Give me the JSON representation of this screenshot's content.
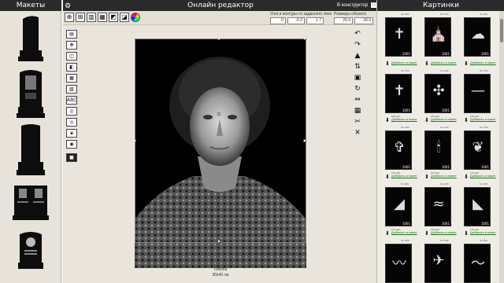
{
  "left_panel": {
    "title": "Макеты"
  },
  "center_panel": {
    "title": "Онлайн редактор",
    "constructor_label": "В конструктор",
    "toolbar": {
      "color_icon": "color-wheel-icon"
    },
    "options": {
      "angle_label": "Угол и контуры от заданного левого угла",
      "angle_value": "0",
      "x_value": "-0.2",
      "y_value": "1.7",
      "size_label": "Размеры объекта",
      "w_value": "29.9",
      "h_value": "39.9"
    },
    "left_tools": [
      {
        "label": "▤"
      },
      {
        "label": "✥"
      },
      {
        "label": "◫"
      },
      {
        "label": "◧"
      },
      {
        "label": "▦"
      },
      {
        "label": "▧"
      },
      {
        "label": "ABC"
      },
      {
        "label": "◎"
      },
      {
        "label": "⌂"
      },
      {
        "label": "◈"
      },
      {
        "label": "◉"
      },
      {
        "label": "■"
      }
    ],
    "right_tools": [
      {
        "label": "↶"
      },
      {
        "label": "↷"
      },
      {
        "label": "▲"
      },
      {
        "label": "⇅"
      },
      {
        "label": "▣"
      },
      {
        "label": "↻"
      },
      {
        "label": "⇔"
      },
      {
        "label": "▦"
      },
      {
        "label": "✂"
      },
      {
        "label": "✕"
      }
    ],
    "canvas_caption_1": "Плитка",
    "canvas_caption_2": "30x40 см"
  },
  "right_panel": {
    "title": "Картинки",
    "add_label": "Добавить в макет",
    "items": [
      {
        "id": "№ 1869",
        "num": "1001",
        "price": ""
      },
      {
        "id": "№ 1875",
        "num": "1001",
        "price": ""
      },
      {
        "id": "№ 2001",
        "num": "1001",
        "price": ""
      },
      {
        "id": "№ 1796",
        "num": "1001",
        "price": "130 руб."
      },
      {
        "id": "№ 1842",
        "num": "1001",
        "price": "170 руб."
      },
      {
        "id": "№ 1794",
        "num": "",
        "price": "170 руб."
      },
      {
        "id": "№ 1905",
        "num": "1001",
        "price": "170 руб."
      },
      {
        "id": "№ 1706",
        "num": "1001",
        "price": "170 руб."
      },
      {
        "id": "№ 1798",
        "num": "1001",
        "price": "170 руб."
      },
      {
        "id": "№ 0002",
        "num": "1001",
        "price": "170 руб."
      },
      {
        "id": "№ 1629",
        "num": "1001",
        "price": "170 руб."
      },
      {
        "id": "№ 1626",
        "num": "1001",
        "price": "170 руб."
      },
      {
        "id": "№ 1809",
        "num": "",
        "price": "170 руб."
      },
      {
        "id": "№ 2066",
        "num": "",
        "price": "170 руб."
      },
      {
        "id": "№ 1811",
        "num": "",
        "price": "170 руб."
      }
    ]
  }
}
